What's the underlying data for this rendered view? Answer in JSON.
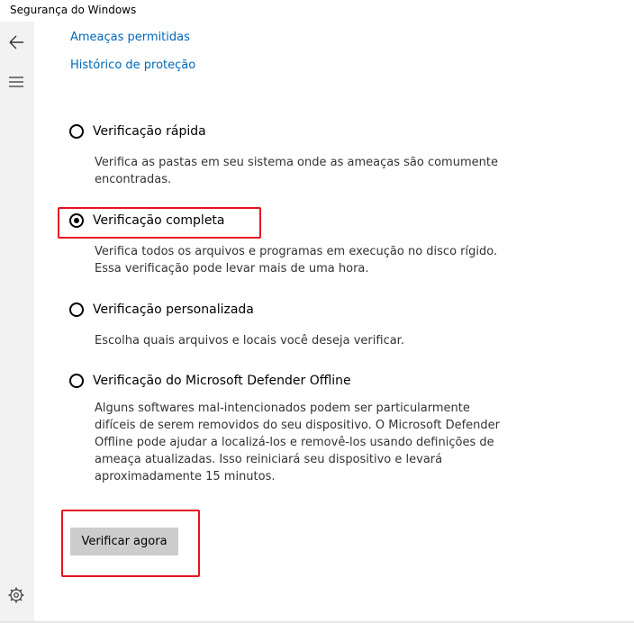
{
  "window": {
    "title": "Segurança do Windows"
  },
  "sidebar": {
    "back_icon": "back-arrow-icon",
    "menu_icon": "hamburger-menu-icon",
    "settings_icon": "gear-icon"
  },
  "links": {
    "allowed_threats": "Ameaças permitidas",
    "protection_history": "Histórico de proteção"
  },
  "scan_options": [
    {
      "label": "Verificação rápida",
      "description_lines": [
        "Verifica as pastas em seu sistema onde as ameaças são comumente",
        "encontradas."
      ],
      "selected": false
    },
    {
      "label": "Verificação completa",
      "description_lines": [
        "Verifica todos os arquivos e programas em execução no disco rígido.",
        "Essa verificação pode levar mais de uma hora."
      ],
      "selected": true
    },
    {
      "label": "Verificação personalizada",
      "description_lines": [
        "Escolha quais arquivos e locais você deseja verificar."
      ],
      "selected": false
    },
    {
      "label": "Verificação do Microsoft Defender Offline",
      "description_lines": [
        "Alguns softwares mal-intencionados podem ser particularmente",
        "difíceis de serem removidos do seu dispositivo. O Microsoft Defender",
        "Offline pode ajudar a localizá-los e removê-los usando definições de",
        "ameaça atualizadas. Isso reiniciará seu dispositivo e levará",
        "aproximadamente 15 minutos."
      ],
      "selected": false
    }
  ],
  "actions": {
    "scan_now": "Verificar agora"
  },
  "colors": {
    "link": "#0067b8",
    "highlight": "#e81123",
    "button": "#cccccc",
    "sidebar": "#f2f2f2"
  }
}
